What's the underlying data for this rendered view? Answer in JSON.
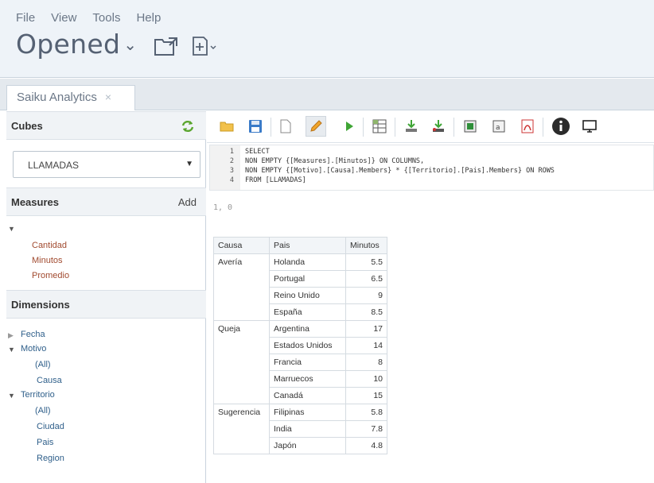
{
  "menu": [
    "File",
    "View",
    "Tools",
    "Help"
  ],
  "header": {
    "opened_label": "Opened",
    "chevron": "⌄"
  },
  "tab": {
    "title": "Saiku Analytics",
    "close": "×"
  },
  "cubes": {
    "title": "Cubes",
    "selected": "LLAMADAS"
  },
  "measures": {
    "title": "Measures",
    "add_label": "Add",
    "items": [
      "Cantidad",
      "Minutos",
      "Promedio"
    ]
  },
  "dimensions": {
    "title": "Dimensions",
    "fecha": "Fecha",
    "motivo": "Motivo",
    "motivo_levels": [
      "(All)",
      "Causa"
    ],
    "territorio": "Territorio",
    "territorio_levels": [
      "(All)",
      "Ciudad",
      "Pais",
      "Region"
    ]
  },
  "editor": {
    "lines": [
      {
        "n": "1",
        "text": "SELECT"
      },
      {
        "n": "2",
        "text": "NON EMPTY {[Measures].[Minutos]} ON COLUMNS,"
      },
      {
        "n": "3",
        "text": "NON EMPTY {[Motivo].[Causa].Members} * {[Territorio].[Pais].Members} ON ROWS"
      },
      {
        "n": "4",
        "text": "FROM [LLAMADAS]"
      }
    ],
    "cursor": "1, 0"
  },
  "table": {
    "headers": [
      "Causa",
      "Pais",
      "Minutos"
    ],
    "groups": [
      {
        "causa": "Avería",
        "rows": [
          {
            "pais": "Holanda",
            "minutos": "5.5"
          },
          {
            "pais": "Portugal",
            "minutos": "6.5"
          },
          {
            "pais": "Reino Unido",
            "minutos": "9"
          },
          {
            "pais": "España",
            "minutos": "8.5"
          }
        ]
      },
      {
        "causa": "Queja",
        "rows": [
          {
            "pais": "Argentina",
            "minutos": "17"
          },
          {
            "pais": "Estados Unidos",
            "minutos": "14"
          },
          {
            "pais": "Francia",
            "minutos": "8"
          },
          {
            "pais": "Marruecos",
            "minutos": "10"
          },
          {
            "pais": "Canadá",
            "minutos": "15"
          }
        ]
      },
      {
        "causa": "Sugerencia",
        "rows": [
          {
            "pais": "Filipinas",
            "minutos": "5.8"
          },
          {
            "pais": "India",
            "minutos": "7.8"
          },
          {
            "pais": "Japón",
            "minutos": "4.8"
          }
        ]
      }
    ]
  },
  "toolbar_icons": [
    "open-folder-icon",
    "save-icon",
    "new-query-icon",
    "edit-pencil-icon",
    "run-icon",
    "table-icon",
    "export-down-icon",
    "export-down-alt-icon",
    "export-excel-icon",
    "export-csv-icon",
    "export-pdf-icon",
    "info-icon",
    "monitor-icon"
  ],
  "colors": {
    "header_bg": "#eef3f8",
    "measure": "#a14a2f",
    "dimension": "#2f5f8a",
    "refresh_green": "#5aa52e"
  }
}
